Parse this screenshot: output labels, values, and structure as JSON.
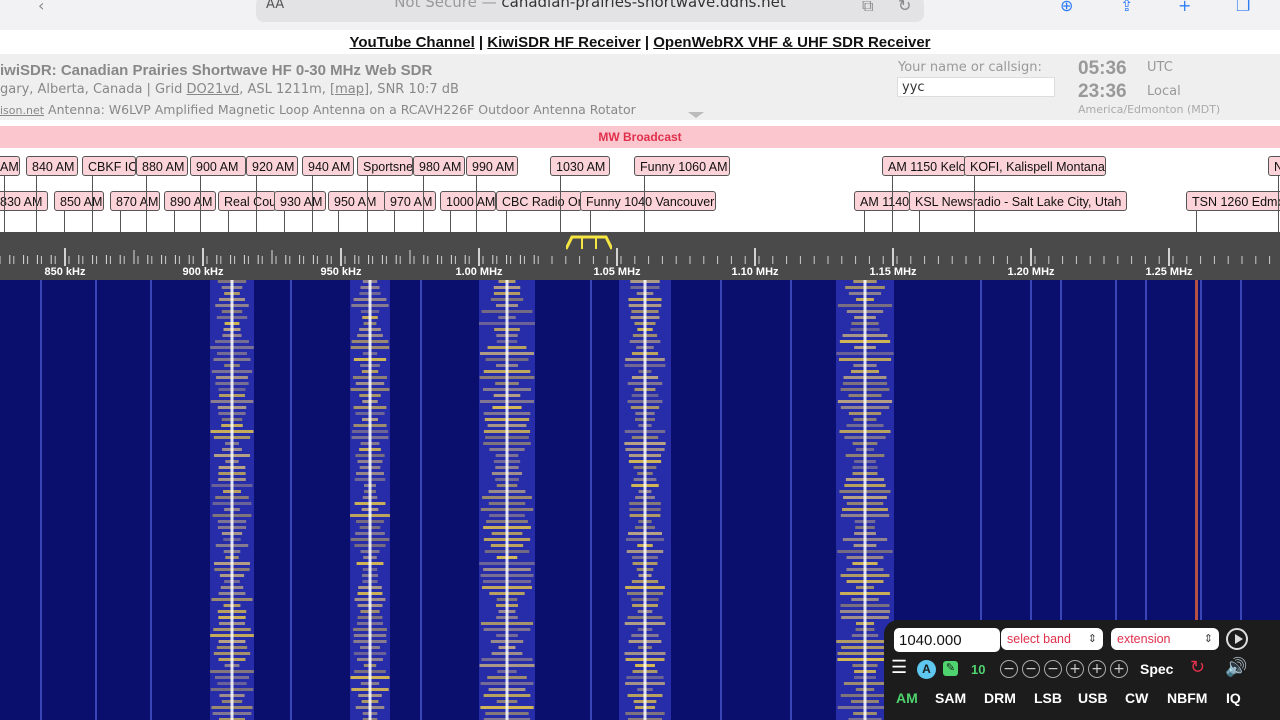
{
  "browser": {
    "text_size_label": "AA",
    "security_label": "Not Secure —",
    "host": "canadian-prairies-shortwave.ddns.net"
  },
  "links": {
    "youtube": "YouTube Channel",
    "sep": "|",
    "kiwisdr": "KiwiSDR HF Receiver",
    "openwebrx": "OpenWebRX VHF & UHF SDR Receiver"
  },
  "header": {
    "title": "iwiSDR: Canadian Prairies Shortwave HF 0-30 MHz Web SDR",
    "location_pre": "gary, Alberta, Canada | Grid ",
    "grid": "DO21vd",
    "location_mid": ", ASL 1211m, ",
    "map": "[map]",
    "location_post": ", SNR 10:7 dB",
    "site": "ison.net",
    "antenna": "Antenna: W6LVP Amplified Magnetic Loop Antenna on a RCAVH226F Outdoor Antenna Rotator",
    "name_label": "Your name or callsign:",
    "name_value": "yyc",
    "utc_time": "05:36",
    "utc_label": "UTC",
    "local_time": "23:36",
    "local_label": "Local",
    "timezone": "America/Edmonton (MDT)"
  },
  "band": {
    "name": "MW Broadcast"
  },
  "stations_row1": [
    "AM",
    "840 AM",
    "CBKF ICI",
    "880 AM",
    "900 AM",
    "920 AM",
    "940 AM",
    "Sportsne",
    "980 AM",
    "990 AM",
    "1030 AM",
    "Funny 1060 AM",
    "AM 1150 Kelo",
    "KOFI, Kalispell Montana",
    "N"
  ],
  "stations_row2": [
    "830 AM",
    "850 AM",
    "870 AM",
    "890 AM",
    "Real Cou",
    "930 AM",
    "950 AM",
    "970 AM",
    "1000 AM",
    "CBC Radio On",
    "Funny 1040 Vancouver",
    "AM 1140",
    "KSL Newsradio - Salt Lake City, Utah",
    "TSN 1260 Edmo"
  ],
  "scale_labels": [
    "850 kHz",
    "900 kHz",
    "950 kHz",
    "1.00 MHz",
    "1.05 MHz",
    "1.10 MHz",
    "1.15 MHz",
    "1.20 MHz",
    "1.25 MHz"
  ],
  "controls": {
    "frequency": "1040.000",
    "band_select": "select band",
    "extension_select": "extension",
    "step_label": "10",
    "spec_label": "Spec",
    "modes": [
      "AM",
      "SAM",
      "DRM",
      "LSB",
      "USB",
      "CW",
      "NBFM",
      "IQ"
    ],
    "active_mode": "AM"
  },
  "colors": {
    "band_bar": "#fbc6ce",
    "band_text": "#e0304c",
    "station_bg": "#fbd3d8",
    "waterfall_bg": "#0a0f6e",
    "active_mode": "#4ed36e"
  }
}
